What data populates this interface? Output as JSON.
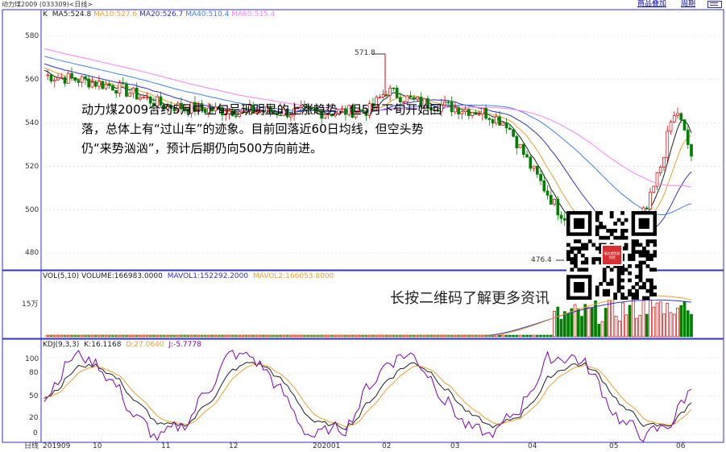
{
  "window": {
    "title": "动力煤2009 (033309)<日线>",
    "links": [
      "商品叠加",
      "周期"
    ],
    "extra_icon": "list-icon"
  },
  "colors": {
    "up": "#e00000",
    "down": "#008000",
    "ma5": "#202020",
    "ma10": "#f0a030",
    "ma20": "#3030d0",
    "ma40": "#4080ff",
    "ma60": "#ff80ff",
    "k_line": "#202020",
    "d_line": "#f0a030",
    "j_line": "#8000c0",
    "axis": "#3030d0",
    "grid": "#d0d0e0"
  },
  "price_panel": {
    "legend_prefix": "K",
    "legend": [
      {
        "label": "MA5:524.8",
        "color": "#202020"
      },
      {
        "label": "MA10:527.6",
        "color": "#f0a030"
      },
      {
        "label": "MA20:526.7",
        "color": "#3030d0"
      },
      {
        "label": "MA40:510.4",
        "color": "#4080ff"
      },
      {
        "label": "MA60:515.4",
        "color": "#ff80ff"
      }
    ],
    "y_ticks": [
      "580",
      "560",
      "540",
      "520",
      "500",
      "480"
    ],
    "high_label": "571.8",
    "low_label": "476.4"
  },
  "volume_panel": {
    "legend": [
      {
        "label": "VOL(5,10) VOLUME:166983.0000",
        "color": "#202020"
      },
      {
        "label": "MAVOL1:152292.2000",
        "color": "#3030d0"
      },
      {
        "label": "MAVOL2:166053.8000",
        "color": "#f0a030"
      }
    ],
    "y_tick": "15万"
  },
  "kdj_panel": {
    "legend": [
      {
        "label": "KDJ(9,3,3)",
        "color": "#202020"
      },
      {
        "label": "K:16.1168",
        "color": "#202020"
      },
      {
        "label": "D:27.0640",
        "color": "#f0a030"
      },
      {
        "label": "J:-5.7778",
        "color": "#8000c0"
      }
    ],
    "y_ticks": [
      "100",
      "80",
      "50",
      "20",
      "0"
    ]
  },
  "x_axis": {
    "period_label": "日线",
    "labels": [
      "201909",
      "10",
      "11",
      "12",
      "202001",
      "02",
      "03",
      "04",
      "05",
      "06"
    ]
  },
  "annotation": {
    "text": "动力煤2009合约5月中上旬呈现明显的上涨趋势，但5月下旬开始回落，总体上有“过山车”的迹象。目前回落近60日均线，但空头势仍“来势汹汹”，预计后期仍向500方向前进。"
  },
  "qr": {
    "caption": "长按二维码了解更多资讯",
    "center_label": "瑞达期货研究院"
  }
}
